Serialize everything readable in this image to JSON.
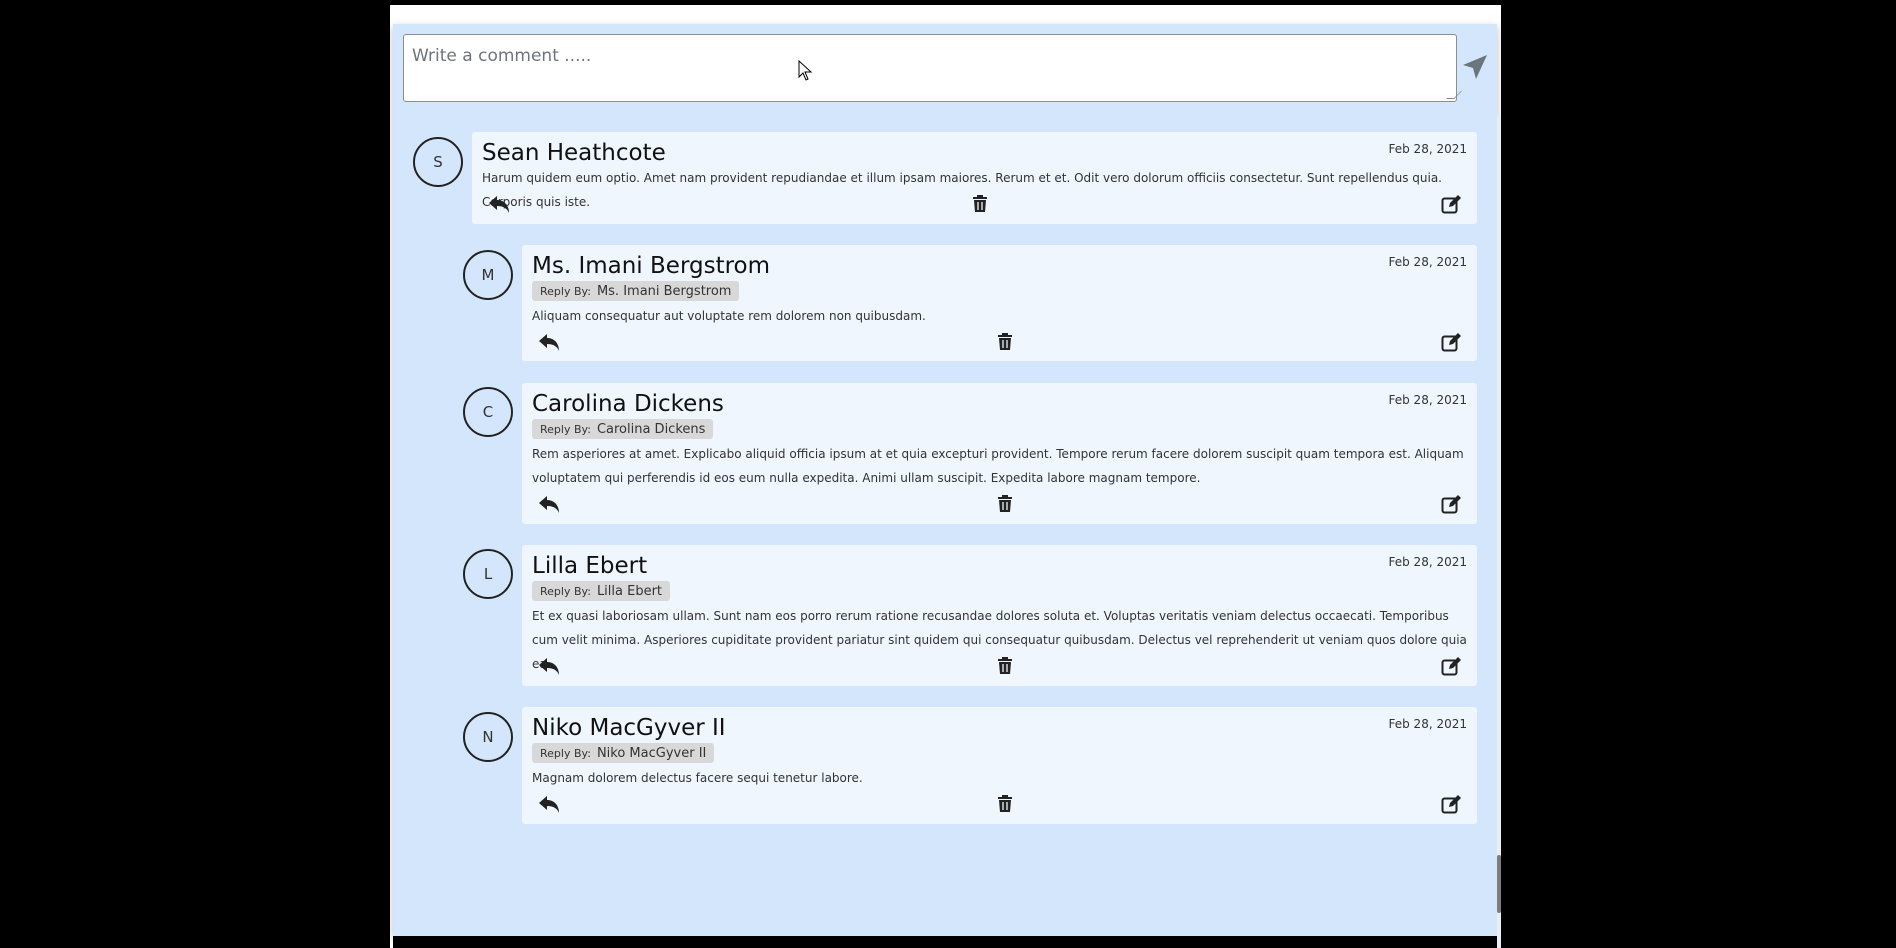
{
  "composer": {
    "placeholder": "Write a comment .....",
    "send_icon": "paper-plane-icon"
  },
  "comments": [
    {
      "initial": "S",
      "author": "Sean Heathcote",
      "date": "Feb 28, 2021",
      "reply_by": "",
      "body": "Harum quidem eum optio. Amet nam provident repudiandae et illum ipsam maiores. Rerum et et. Odit vero dolorum officiis consectetur. Sunt repellendus quia. Corporis quis iste."
    },
    {
      "initial": "M",
      "author": "Ms. Imani Bergstrom",
      "date": "Feb 28, 2021",
      "reply_by_label": "Reply By:",
      "reply_by": "Ms. Imani Bergstrom",
      "body": "Aliquam consequatur aut voluptate rem dolorem non quibusdam."
    },
    {
      "initial": "C",
      "author": "Carolina Dickens",
      "date": "Feb 28, 2021",
      "reply_by_label": "Reply By:",
      "reply_by": "Carolina Dickens",
      "body": "Rem asperiores at amet. Explicabo aliquid officia ipsum at et quia excepturi provident. Tempore rerum facere dolorem suscipit quam tempora est. Aliquam voluptatem qui perferendis id eos eum nulla expedita. Animi ullam suscipit. Expedita labore magnam tempore."
    },
    {
      "initial": "L",
      "author": "Lilla Ebert",
      "date": "Feb 28, 2021",
      "reply_by_label": "Reply By:",
      "reply_by": "Lilla Ebert",
      "body": "Et ex quasi laboriosam ullam. Sunt nam eos porro rerum ratione recusandae dolores soluta et. Voluptas veritatis veniam delectus occaecati. Temporibus cum velit minima. Asperiores cupiditate provident pariatur sint quidem qui consequatur quibusdam. Delectus vel reprehenderit ut veniam quos dolore quia ea."
    },
    {
      "initial": "N",
      "author": "Niko MacGyver II",
      "date": "Feb 28, 2021",
      "reply_by_label": "Reply By:",
      "reply_by": "Niko MacGyver II",
      "body": "Magnam dolorem delectus facere sequi tenetur labore."
    }
  ],
  "icons": {
    "reply": "reply-arrow-icon",
    "delete": "trash-icon",
    "edit": "edit-icon"
  }
}
